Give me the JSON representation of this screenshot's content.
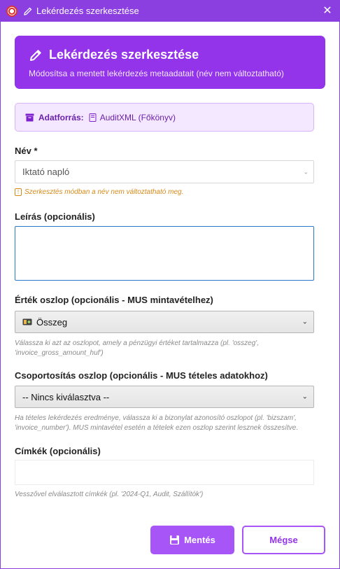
{
  "window": {
    "title": "Lekérdezés szerkesztése",
    "close_label": "✕"
  },
  "header": {
    "title": "Lekérdezés szerkesztése",
    "subtitle": "Módosítsa a mentett lekérdezés metaadatait (név nem változtatható)"
  },
  "datasource": {
    "label": "Adatforrás:",
    "value": "AuditXML (Főkönyv)"
  },
  "name_field": {
    "label": "Név *",
    "value": "Iktató napló",
    "warning": "Szerkesztés módban a név nem változtatható meg."
  },
  "description_field": {
    "label": "Leírás (opcionális)",
    "value": ""
  },
  "value_column": {
    "label": "Érték oszlop (opcionális - MUS mintavételhez)",
    "selected": "Összeg",
    "hint_line1": "Válassza ki azt az oszlopot, amely a pénzügyi értéket tartalmazza (pl. 'osszeg',",
    "hint_line2": "'invoice_gross_amount_huf')"
  },
  "group_column": {
    "label": "Csoportosítás oszlop (opcionális - MUS tételes adatokhoz)",
    "selected": "-- Nincs kiválasztva --",
    "hint_line1": "Ha tételes lekérdezés eredménye, válassza ki a bizonylat azonosító oszlopot (pl. 'bizszam',",
    "hint_line2": "'invoice_number'). MUS mintavétel esetén a tételek ezen oszlop szerint lesznek összesítve."
  },
  "tags_field": {
    "label": "Címkék (opcionális)",
    "value": "",
    "hint": "Vesszővel elválasztott címkék (pl. '2024-Q1, Audit, Szállítók')"
  },
  "buttons": {
    "save": "Mentés",
    "cancel": "Mégse"
  },
  "colors": {
    "accent": "#9333ea",
    "titlebar": "#8b3fe0",
    "warning": "#d68a1a"
  }
}
